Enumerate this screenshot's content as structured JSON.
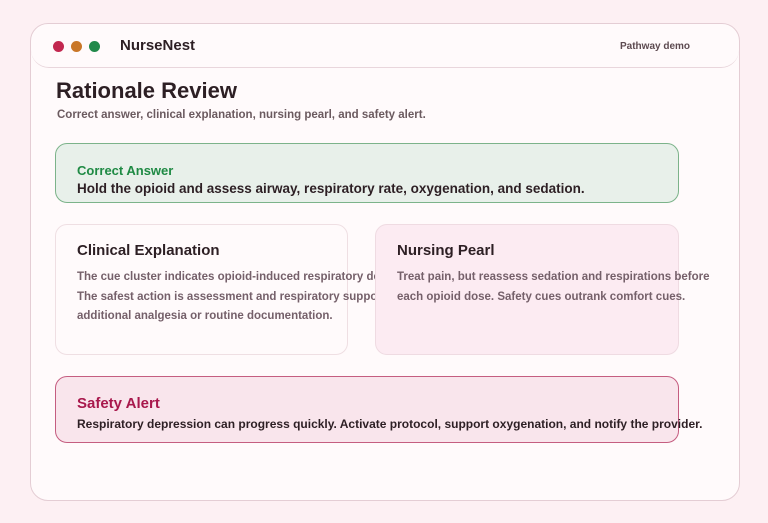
{
  "app": {
    "name": "NurseNest",
    "mode_label": "Pathway demo"
  },
  "page": {
    "title": "Rationale Review",
    "subtitle": "Correct answer, clinical explanation, nursing pearl, and safety alert."
  },
  "correct_answer": {
    "label": "Correct Answer",
    "text": "Hold the opioid and assess airway, respiratory rate, oxygenation, and sedation."
  },
  "clinical_explanation": {
    "title": "Clinical Explanation",
    "lines": [
      "The cue cluster indicates opioid-induced respiratory depression.",
      "The safest action is assessment and respiratory support before",
      "additional analgesia or routine documentation."
    ]
  },
  "nursing_pearl": {
    "title": "Nursing Pearl",
    "lines": [
      "Treat pain, but reassess sedation and respirations before",
      "each opioid dose. Safety cues outrank comfort cues."
    ]
  },
  "safety_alert": {
    "label": "Safety Alert",
    "text": "Respiratory depression can progress quickly. Activate protocol, support oxygenation, and notify the provider."
  },
  "colors": {
    "window_dot_red": "#c2274f",
    "window_dot_orange": "#c97627",
    "window_dot_green": "#21894a",
    "correct_accent": "#1f8a44",
    "alert_accent": "#a8184c"
  }
}
